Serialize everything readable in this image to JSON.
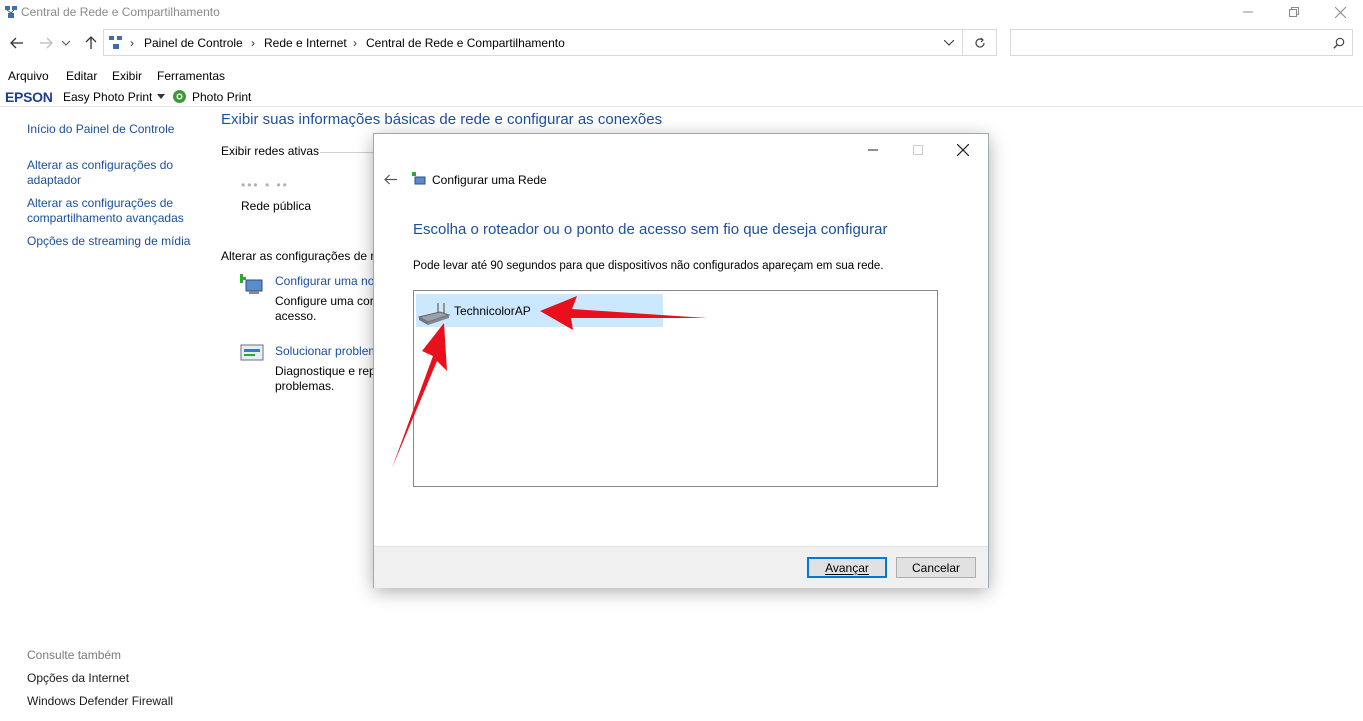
{
  "window": {
    "title": "Central de Rede e Compartilhamento"
  },
  "address": {
    "crumbs": [
      "Painel de Controle",
      "Rede e Internet",
      "Central de Rede e Compartilhamento"
    ],
    "search_placeholder": ""
  },
  "menu": {
    "items": [
      "Arquivo",
      "Editar",
      "Exibir",
      "Ferramentas"
    ]
  },
  "toolbar": {
    "brand": "EPSON",
    "easy_photo_print": "Easy Photo Print",
    "photo_print": "Photo Print"
  },
  "sidebar": {
    "links": [
      "Início do Painel de Controle",
      "Alterar as configurações do adaptador",
      "Alterar as configurações de compartilhamento avançadas",
      "Opções de streaming de mídia"
    ],
    "see_also_label": "Consulte também",
    "see_also": [
      "Opções da Internet",
      "Windows Defender Firewall"
    ]
  },
  "main": {
    "heading": "Exibir suas informações básicas de rede e configurar as conexões",
    "active_networks_label": "Exibir redes ativas",
    "network_name_obscured": "••• • ••",
    "network_type": "Rede pública",
    "change_settings_label": "Alterar as configurações de re",
    "tasks": [
      {
        "title": "Configurar uma no",
        "desc_line1": "Configure uma cor",
        "desc_line2": "acesso."
      },
      {
        "title": "Solucionar problem",
        "desc_line1": "Diagnostique e rep",
        "desc_line2": "problemas."
      }
    ]
  },
  "dialog": {
    "title": "Configurar uma Rede",
    "heading": "Escolha o roteador ou o ponto de acesso sem fio que deseja configurar",
    "subtext": "Pode levar até 90 segundos para que dispositivos não configurados apareçam em sua rede.",
    "devices": [
      "TechnicolorAP"
    ],
    "next_button": "Avançar",
    "cancel_button": "Cancelar"
  },
  "colors": {
    "link": "#1a4fa0",
    "heading": "#1e4f9c",
    "selection": "#cce8ff",
    "annotation_arrow": "#e8101a"
  }
}
